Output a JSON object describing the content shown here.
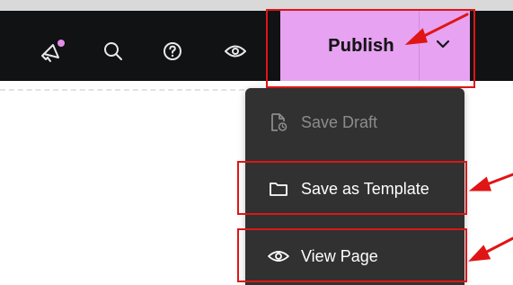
{
  "toolbar": {
    "icons": {
      "announcements": "megaphone-icon",
      "search": "search-icon",
      "help": "help-icon",
      "preview": "eye-icon"
    },
    "notification_dot_color": "#e58be8",
    "publish_label": "Publish",
    "publish_bg_color": "#e7a2f2",
    "toolbar_bg_color": "#111213"
  },
  "menu": {
    "items": [
      {
        "label": "Save Draft",
        "icon": "file-clock-icon",
        "disabled": true
      },
      {
        "label": "Save as Template",
        "icon": "folder-icon",
        "disabled": false
      },
      {
        "label": "View Page",
        "icon": "eye-icon",
        "disabled": false
      }
    ],
    "bg_color": "#313131"
  },
  "annotations": {
    "highlight_color": "#e01515"
  }
}
